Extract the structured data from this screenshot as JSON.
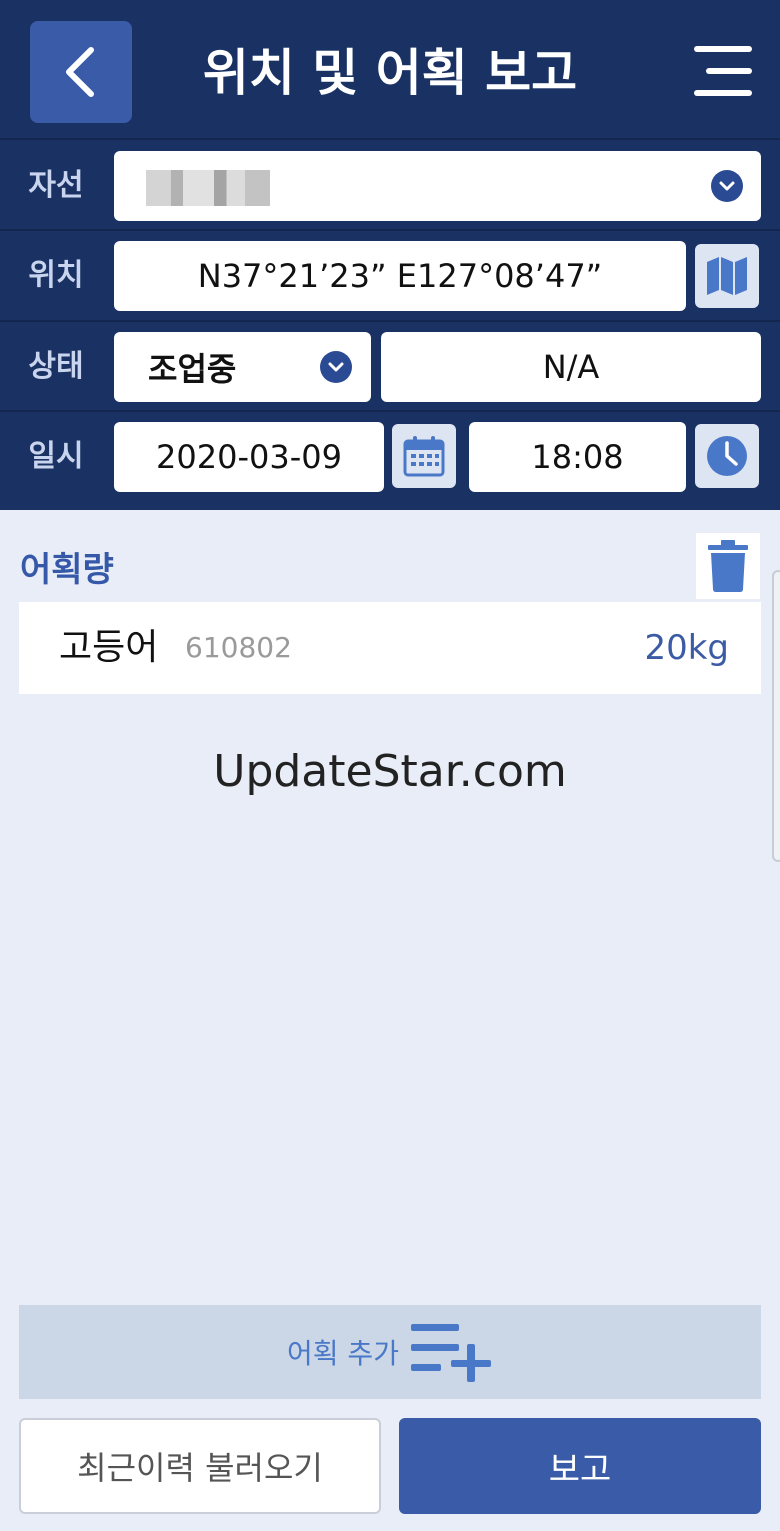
{
  "header": {
    "title": "위치 및 어획 보고"
  },
  "form": {
    "vessel": {
      "label": "자선"
    },
    "position": {
      "label": "위치",
      "value": "N37°21’23” E127°08’47”"
    },
    "status": {
      "label": "상태",
      "value": "조업중",
      "extra": "N/A"
    },
    "datetime": {
      "label": "일시",
      "date": "2020-03-09",
      "time": "18:08"
    }
  },
  "catch": {
    "title": "어획량",
    "items": [
      {
        "name": "고등어",
        "code": "610802",
        "weight": "20kg"
      }
    ]
  },
  "watermark": "UpdateStar.com",
  "actions": {
    "add_catch": "어획 추가",
    "load_history": "최근이력 불러오기",
    "report": "보고"
  },
  "colors": {
    "header_bg": "#1a3263",
    "accent": "#3a5ba8",
    "page_bg": "#e8edf7"
  }
}
